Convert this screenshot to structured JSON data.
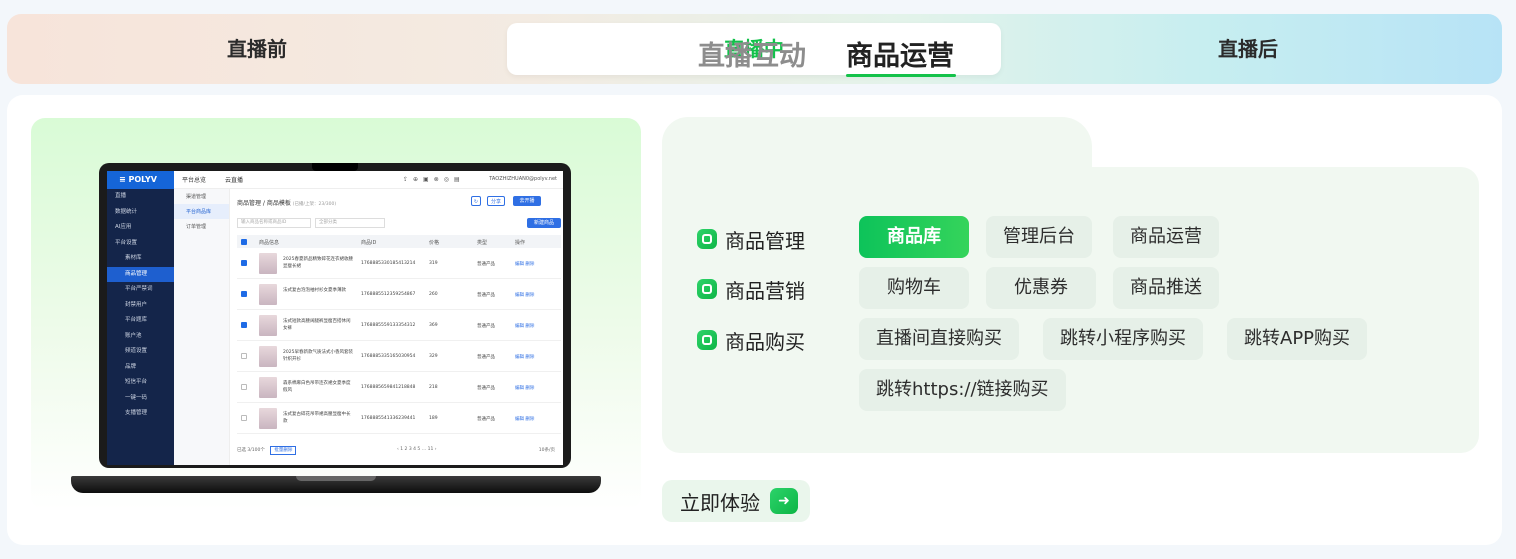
{
  "phases": [
    "直播前",
    "直播中",
    "直播后"
  ],
  "right": {
    "tabs": [
      "直播互动",
      "商品运营"
    ],
    "rows": [
      {
        "label": "商品管理",
        "chips": [
          "商品库",
          "管理后台",
          "商品运营"
        ]
      },
      {
        "label": "商品营销",
        "chips": [
          "购物车",
          "优惠券",
          "商品推送"
        ]
      },
      {
        "label": "商品购买",
        "chips": [
          "直播间直接购买",
          "跳转小程序购买",
          "跳转APP购买",
          "跳转https://链接购买"
        ]
      }
    ],
    "cta": "立即体验",
    "cta_icon": "arrow-right-icon"
  },
  "screen": {
    "logo": "POLYV",
    "crumb1": "平台总览",
    "crumb2": "云直播",
    "account": "TAOZHIZHUAN0@polyv.net",
    "sidebar": [
      "直播",
      "数据统计",
      "AI应用",
      "平台设置",
      "素材库",
      "商品管理",
      "平台严禁词",
      "封禁用户",
      "平台题库",
      "账户池",
      "频道设置",
      "品牌",
      "短信平台",
      "一键一码",
      "支播管理"
    ],
    "sub_sidebar": [
      "渠道管理",
      "平台商品库",
      "订单管理"
    ],
    "title": "商品管理 / 商品模板",
    "title_note": "(已播/上架：23/300)",
    "btn_share": "分享",
    "btn_add": "去开播",
    "btn_new": "新建商品",
    "search_placeholder": "输入商品名称或商品ID",
    "select_placeholder": "全部分类",
    "columns": [
      "商品信息",
      "商品ID",
      "价格",
      "类型",
      "操作"
    ],
    "rows": [
      {
        "name": "2025春夏新品精致碎花连衣裙收腰显瘦长裙",
        "id": "1768885330185413214",
        "price": "319",
        "type": "普通产品",
        "ops": "编辑  删除",
        "checked": true
      },
      {
        "name": "法式复古泡泡袖衬衫女夏季薄款",
        "id": "1768885512359254867",
        "price": "260",
        "type": "普通产品",
        "ops": "编辑  删除",
        "checked": true
      },
      {
        "name": "法式短款高腰阔腿裤显瘦百搭休闲女裤",
        "id": "1768885559133354312",
        "price": "369",
        "type": "普通产品",
        "ops": "编辑  删除",
        "checked": true
      },
      {
        "name": "2025早春新款气质法式小香风套装针织开衫",
        "id": "1768885335165030954",
        "price": "329",
        "type": "普通产品",
        "ops": "编辑  删除",
        "checked": false
      },
      {
        "name": "森系棉麻白色吊带连衣裙女夏季度假风",
        "id": "1768885659841218848",
        "price": "218",
        "type": "普通产品",
        "ops": "编辑  删除",
        "checked": false
      },
      {
        "name": "法式复古碎花吊带裙高腰显瘦中长款",
        "id": "1768885541336239441",
        "price": "189",
        "type": "普通产品",
        "ops": "编辑  删除",
        "checked": false
      }
    ],
    "pager_total": "已选 3/100个",
    "pager_btn": "批量删除",
    "pages": "‹  1  2  3  4  5  …  11  ›",
    "per_page": "10条/页"
  }
}
